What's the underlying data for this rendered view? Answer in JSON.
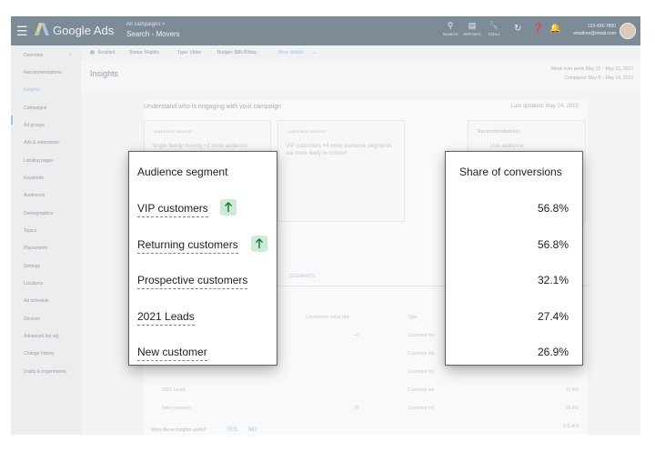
{
  "header": {
    "brand": "Google Ads",
    "breadcrumb_parent": "All campaigns >",
    "breadcrumb_current": "Search - Movers",
    "tools": [
      {
        "icon": "search-icon",
        "label": "SEARCH"
      },
      {
        "icon": "reports-icon",
        "label": "REPORTS"
      },
      {
        "icon": "tools-icon",
        "label": "TOOLS"
      }
    ],
    "account_id": "123-456-7890",
    "account_email": "emailme@email.com"
  },
  "sidebar": {
    "items": [
      {
        "label": "Overview",
        "icon": "home-icon"
      },
      {
        "label": "Recommendations"
      },
      {
        "label": "Insights",
        "selected": true
      },
      {
        "label": "Campaigns"
      },
      {
        "label": "Ad groups"
      },
      {
        "label": "Ads & extensions"
      },
      {
        "label": "Landing pages"
      },
      {
        "label": "Keywords"
      },
      {
        "label": "Audiences"
      },
      {
        "label": "Demographics"
      },
      {
        "label": "Topics"
      },
      {
        "label": "Placements"
      },
      {
        "label": "Settings"
      },
      {
        "label": "Locations"
      },
      {
        "label": "Ad schedule"
      },
      {
        "label": "Devices"
      },
      {
        "label": "Advanced bid adj."
      },
      {
        "label": "Change history"
      },
      {
        "label": "Drafts & experiments"
      }
    ]
  },
  "campaign_bar": {
    "status": "Enabled",
    "status_color": "#34a853",
    "status_detail": "Status: Eligible",
    "type": "Type: Video",
    "budget": "Budget: $88.00/day",
    "more": "More details"
  },
  "page": {
    "title": "Insights",
    "date_range": "Week over week   May 15 – May 21, 2022",
    "compared": "Compared: May 8 – May 14, 2022"
  },
  "background": {
    "section_title": "Understand who is engaging with your campaign",
    "last_updated": "Last updated: May 24, 2022",
    "cards": [
      {
        "kicker": "AUDIENCE INSIGHT",
        "text": "Single family moving +2 more audience"
      },
      {
        "kicker": "AUDIENCE INSIGHT",
        "text": "VIP customers +4 more audience segments are more likely to convert"
      }
    ],
    "recommendations_title": "Recommendations",
    "recommendation_item": "Use audience",
    "tab_label": "SEGMENTS",
    "columns": [
      "Conversion value rate",
      "Type"
    ],
    "rows": [
      {
        "name": "",
        "rate": "+1",
        "type": "Customer list",
        "share": ""
      },
      {
        "name": "",
        "rate": "-",
        "type": "Customer list",
        "share": ""
      },
      {
        "name": "",
        "rate": "-",
        "type": "Customer list",
        "share": ""
      },
      {
        "name": "2021 Leads",
        "rate": "-",
        "type": "Customer list",
        "share": "27.4%"
      },
      {
        "name": "New customer",
        "rate": "20",
        "type": "Customer list",
        "share": "26.9%"
      }
    ],
    "pagination": "1-5 of 5",
    "feedback_question": "Were these insights useful?",
    "feedback_yes": "YES",
    "feedback_no": "NO"
  },
  "overlay_left": {
    "header": "Audience segment",
    "segments": [
      {
        "label": "VIP customers",
        "trend": "up"
      },
      {
        "label": "Returning customers",
        "trend": "up"
      },
      {
        "label": "Prospective customers"
      },
      {
        "label": "2021 Leads"
      },
      {
        "label": "New customer"
      }
    ],
    "trend_badge_color": "#ceead6"
  },
  "overlay_right": {
    "header": "Share of conversions",
    "values": [
      "56.8%",
      "56.8%",
      "32.1%",
      "27.4%",
      "26.9%"
    ]
  }
}
